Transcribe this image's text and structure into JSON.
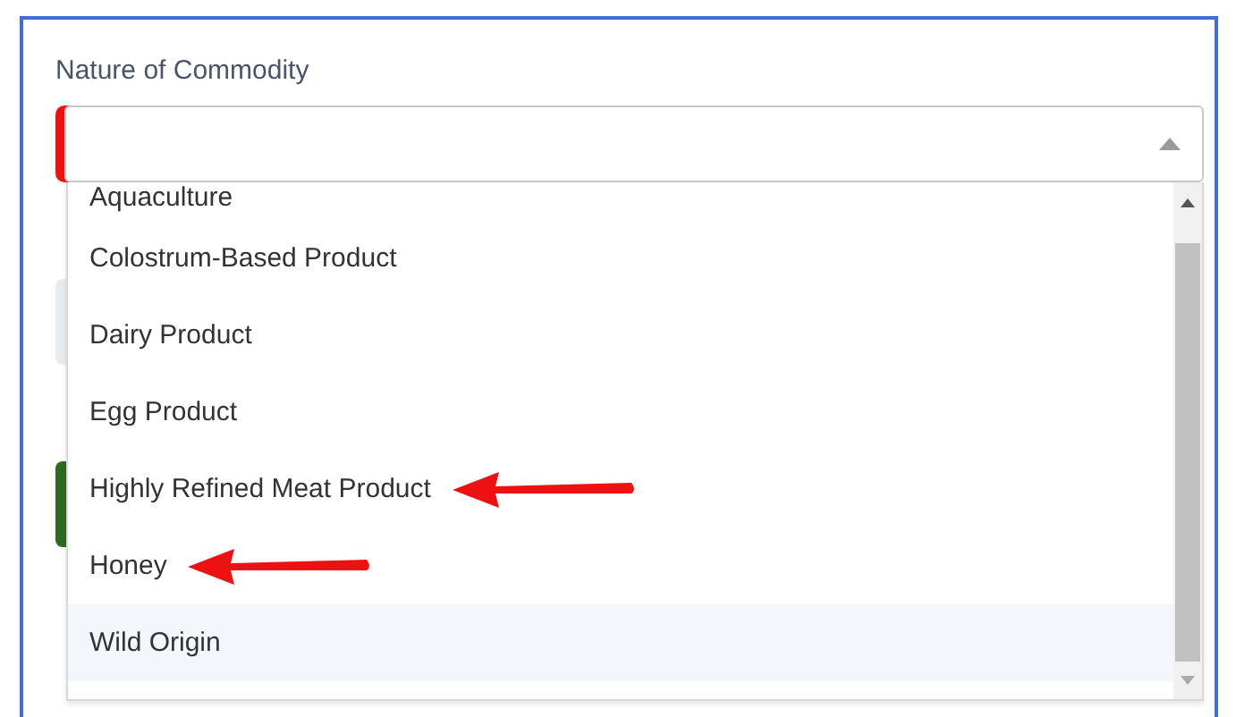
{
  "field": {
    "label": "Nature of Commodity",
    "required": true,
    "expanded": true
  },
  "options": [
    {
      "label": "Aquaculture",
      "highlighted": false,
      "marked": false
    },
    {
      "label": "Colostrum-Based Product",
      "highlighted": false,
      "marked": false
    },
    {
      "label": "Dairy Product",
      "highlighted": false,
      "marked": false
    },
    {
      "label": "Egg Product",
      "highlighted": false,
      "marked": false
    },
    {
      "label": "Highly Refined Meat Product",
      "highlighted": false,
      "marked": true
    },
    {
      "label": "Honey",
      "highlighted": false,
      "marked": true
    },
    {
      "label": "Wild Origin",
      "highlighted": true,
      "marked": false
    }
  ],
  "background_fields": [
    {
      "kind": "grey"
    },
    {
      "kind": "green"
    }
  ]
}
